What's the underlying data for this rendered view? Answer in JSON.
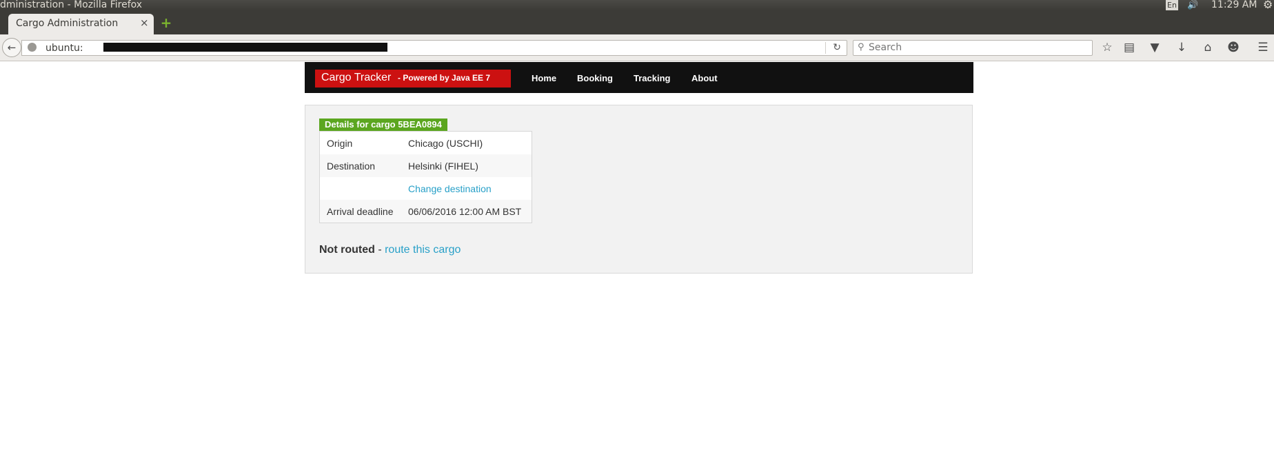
{
  "window": {
    "title": "dministration - Mozilla Firefox",
    "indicator_lang": "En",
    "clock": "11:29 AM"
  },
  "tabs": [
    {
      "label": "Cargo Administration",
      "active": true
    }
  ],
  "toolbar": {
    "url": "ubuntu:",
    "search_placeholder": "Search",
    "icons": [
      "back-icon",
      "globe-icon",
      "reload-icon",
      "search-icon",
      "star-icon",
      "reading-list-icon",
      "pocket-icon",
      "download-icon",
      "home-icon",
      "chat-icon",
      "menu-icon"
    ]
  },
  "site": {
    "brand": "Cargo Tracker",
    "brand_sub": "- Powered by Java EE 7",
    "nav": [
      "Home",
      "Booking",
      "Tracking",
      "About"
    ]
  },
  "details": {
    "caption": "Details for cargo 5BEA0894",
    "rows": [
      {
        "label": "Origin",
        "value": "Chicago (USCHI)"
      },
      {
        "label": "Destination",
        "value": "Helsinki (FIHEL)"
      },
      {
        "label": "",
        "link": "Change destination"
      },
      {
        "label": "Arrival deadline",
        "value": "06/06/2016 12:00 AM BST"
      }
    ]
  },
  "routing": {
    "status": "Not routed",
    "separator": " - ",
    "action": "route this cargo"
  },
  "colors": {
    "brand_red": "#cc1111",
    "header_bg": "#111111",
    "caption_green": "#5ba61f",
    "link_blue": "#28a0c8"
  }
}
